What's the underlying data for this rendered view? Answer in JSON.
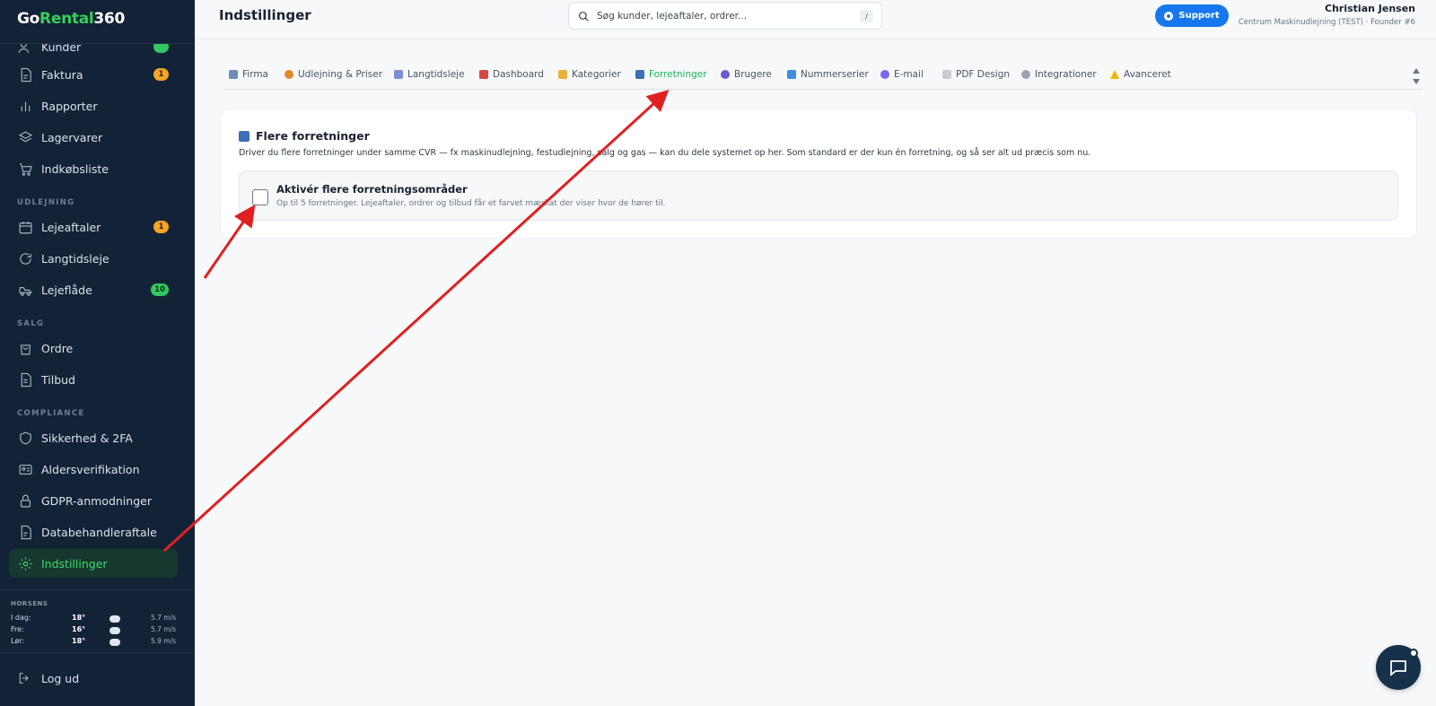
{
  "app": {
    "logo_part1": "Go",
    "logo_part2": "Rental",
    "logo_part3": "360"
  },
  "sidebar": {
    "items": [
      {
        "label": "Kunder",
        "badge": "",
        "icon": "users-icon"
      },
      {
        "label": "Faktura",
        "badge": "1",
        "icon": "invoice-icon"
      },
      {
        "label": "Rapporter",
        "badge": "",
        "icon": "bar-chart-icon"
      },
      {
        "label": "Lagervarer",
        "badge": "",
        "icon": "layers-icon"
      },
      {
        "label": "Indkøbsliste",
        "badge": "",
        "icon": "cart-icon"
      },
      {
        "label": "Lejeaftaler",
        "badge": "1",
        "icon": "calendar-icon"
      },
      {
        "label": "Langtidsleje",
        "badge": "",
        "icon": "refresh-icon"
      },
      {
        "label": "Lejeflåde",
        "badge": "10",
        "icon": "truck-icon"
      },
      {
        "label": "Ordre",
        "badge": "",
        "icon": "bag-icon"
      },
      {
        "label": "Tilbud",
        "badge": "",
        "icon": "document-icon"
      },
      {
        "label": "Sikkerhed & 2FA",
        "badge": "",
        "icon": "shield-icon"
      },
      {
        "label": "Aldersverifikation",
        "badge": "",
        "icon": "id-card-icon"
      },
      {
        "label": "GDPR-anmodninger",
        "badge": "",
        "icon": "lock-icon"
      },
      {
        "label": "Databehandleraftale",
        "badge": "",
        "icon": "file-icon"
      },
      {
        "label": "Indstillinger",
        "badge": "",
        "icon": "gear-icon"
      }
    ],
    "sections": {
      "udlejning": "UDLEJNING",
      "salg": "SALG",
      "compliance": "COMPLIANCE"
    },
    "weather": {
      "city": "HORSENS",
      "rows": [
        {
          "day": "I dag:",
          "temp": "18°",
          "wind": "5.7 m/s"
        },
        {
          "day": "Fre:",
          "temp": "16°",
          "wind": "5.7 m/s"
        },
        {
          "day": "Lør:",
          "temp": "18°",
          "wind": "5.9 m/s"
        }
      ]
    },
    "logout": "Log ud"
  },
  "header": {
    "title": "Indstillinger",
    "search_placeholder": "Søg kunder, lejeaftaler, ordrer...",
    "search_shortcut": "/",
    "support_label": "Support",
    "user_name": "Christian Jensen",
    "user_org": "Centrum Maskinudlejning (TEST) · Founder #6"
  },
  "tabs": [
    {
      "label": "Firma",
      "color": "#6b8fb5"
    },
    {
      "label": "Udlejning & Priser",
      "color": "#e0892a"
    },
    {
      "label": "Langtidsleje",
      "color": "#7c8fd6"
    },
    {
      "label": "Dashboard",
      "color": "#d64545"
    },
    {
      "label": "Kategorier",
      "color": "#e8b23a"
    },
    {
      "label": "Forretninger",
      "color": "#3b6fb6"
    },
    {
      "label": "Brugere",
      "color": "#6a5acd"
    },
    {
      "label": "Nummerserier",
      "color": "#3d8ee0"
    },
    {
      "label": "E-mail",
      "color": "#7b68ee"
    },
    {
      "label": "PDF Design",
      "color": "#c9c9d6"
    },
    {
      "label": "Integrationer",
      "color": "#9aa5b1"
    },
    {
      "label": "Avanceret",
      "color": "#f2b705"
    }
  ],
  "active_tab": "Forretninger",
  "card": {
    "title": "Flere forretninger",
    "description": "Driver du flere forretninger under samme CVR — fx maskinudlejning, festudlejning, salg og gas — kan du dele systemet op her. Som standard er der kun én forretning, og så ser alt ud præcis som nu.",
    "option_title": "Aktivér flere forretningsområder",
    "option_desc": "Op til 5 forretninger. Lejeaftaler, ordrer og tilbud får et farvet mærkat der viser hvor de hører til.",
    "option_checked": false
  },
  "colors": {
    "sidebar_bg": "#132337",
    "accent_green": "#3ddc6f",
    "support_blue": "#1677ee",
    "annotation_red": "#e02020"
  }
}
